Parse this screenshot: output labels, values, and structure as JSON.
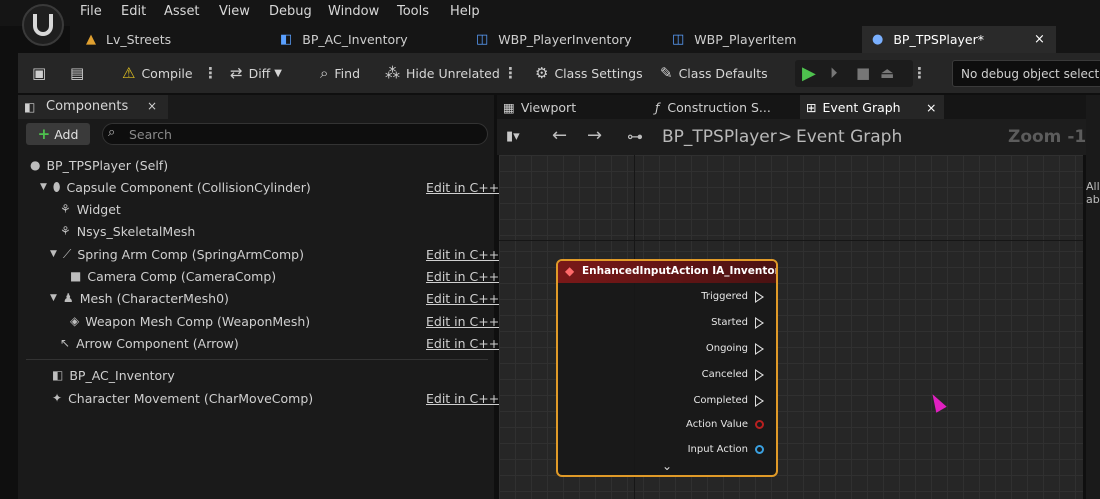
{
  "menu": [
    "File",
    "Edit",
    "Asset",
    "View",
    "Debug",
    "Window",
    "Tools",
    "Help"
  ],
  "doc_tabs": [
    {
      "label": "Lv_Streets",
      "icon": "level-icon"
    },
    {
      "label": "BP_AC_Inventory",
      "icon": "blueprint-component-icon"
    },
    {
      "label": "WBP_PlayerInventory",
      "icon": "widget-blueprint-icon"
    },
    {
      "label": "WBP_PlayerItem",
      "icon": "widget-blueprint-icon"
    },
    {
      "label": "BP_TPSPlayer*",
      "icon": "character-icon",
      "close": "×"
    }
  ],
  "toolbar": {
    "compile": "Compile",
    "diff": "Diff",
    "find": "Find",
    "hide_unrelated": "Hide Unrelated",
    "class_settings": "Class Settings",
    "class_defaults": "Class Defaults",
    "debug_object": "No debug object selected"
  },
  "components_panel": {
    "title": "Components",
    "close": "×",
    "add": "Add",
    "search_placeholder": "Search",
    "items": [
      {
        "label": "BP_TPSPlayer (Self)",
        "edit": ""
      },
      {
        "label": "Capsule Component (CollisionCylinder)",
        "edit": "Edit in C++"
      },
      {
        "label": "Widget",
        "edit": ""
      },
      {
        "label": "Nsys_SkeletalMesh",
        "edit": ""
      },
      {
        "label": "Spring Arm Comp (SpringArmComp)",
        "edit": "Edit in C++"
      },
      {
        "label": "Camera Comp (CameraComp)",
        "edit": "Edit in C++"
      },
      {
        "label": "Mesh (CharacterMesh0)",
        "edit": "Edit in C++"
      },
      {
        "label": "Weapon Mesh Comp (WeaponMesh)",
        "edit": "Edit in C++"
      },
      {
        "label": "Arrow Component (Arrow)",
        "edit": "Edit in C++"
      },
      {
        "label": "BP_AC_Inventory",
        "edit": ""
      },
      {
        "label": "Character Movement (CharMoveComp)",
        "edit": "Edit in C++"
      }
    ]
  },
  "graph_tabs": [
    {
      "label": "Viewport"
    },
    {
      "label": "Construction S..."
    },
    {
      "label": "Event Graph",
      "close": "×"
    }
  ],
  "graph": {
    "crumb_root": "BP_TPSPlayer",
    "crumb_sep": ">",
    "crumb_leaf": "Event Graph",
    "zoom": "Zoom -1"
  },
  "node": {
    "title": "EnhancedInputAction IA_Inventory",
    "pins": [
      "Triggered",
      "Started",
      "Ongoing",
      "Canceled",
      "Completed",
      "Action Value",
      "Input Action"
    ],
    "expand": "⌄"
  },
  "details_snippet": [
    "All",
    "ab"
  ],
  "colors": {
    "accent_orange": "#e09a28",
    "node_header": "#7a1818",
    "play_green": "#4ec24e"
  }
}
